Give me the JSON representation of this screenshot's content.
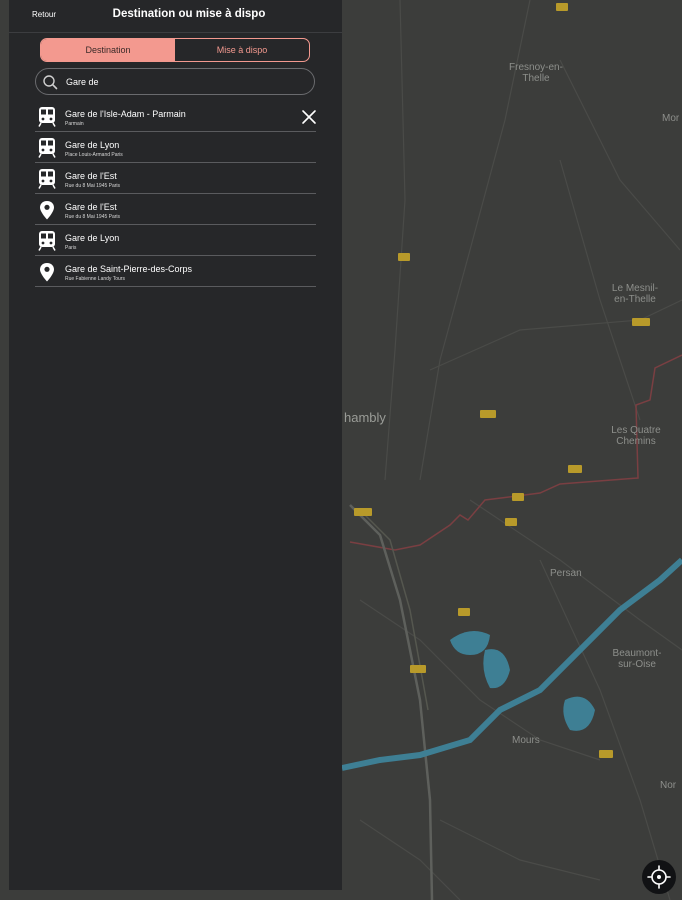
{
  "header": {
    "back_label": "Retour",
    "title": "Destination ou mise à dispo"
  },
  "segmented": {
    "tabs": [
      {
        "label": "Destination",
        "active": true
      },
      {
        "label": "Mise à dispo",
        "active": false
      }
    ]
  },
  "search": {
    "value": "Gare de",
    "icon": "search-icon"
  },
  "results": [
    {
      "title": "Gare de l'Isle-Adam - Parmain",
      "subtitle": "Parmain",
      "icon": "train-icon",
      "clear_icon": "close-icon"
    },
    {
      "title": "Gare de Lyon",
      "subtitle": "Place Louis-Armand Paris",
      "icon": "train-icon"
    },
    {
      "title": "Gare de l'Est",
      "subtitle": "Rue du 8 Mai 1945 Paris",
      "icon": "train-icon"
    },
    {
      "title": "Gare de l'Est",
      "subtitle": "Rue du 8 Mai 1945 Paris",
      "icon": "location-pin-icon"
    },
    {
      "title": "Gare de Lyon",
      "subtitle": "Paris",
      "icon": "train-icon"
    },
    {
      "title": "Gare de Saint-Pierre-des-Corps",
      "subtitle": "Rue Fabienne Landy Tours",
      "icon": "location-pin-icon"
    }
  ],
  "map": {
    "places": [
      "Fresnoy-en-Thelle",
      "Le Mesnil-en-Thelle",
      "Les Quatre Chemins",
      "hambly",
      "Persan",
      "Beaumont-sur-Oise",
      "Mours",
      "Mor",
      "Nor"
    ],
    "colors": {
      "background": "#3c3d3b",
      "river": "#3e7f94",
      "border": "#8a4a4c",
      "panel": "#262729",
      "accent": "#f3998f"
    }
  },
  "locate_button": {
    "icon": "locate-crosshair-icon"
  }
}
